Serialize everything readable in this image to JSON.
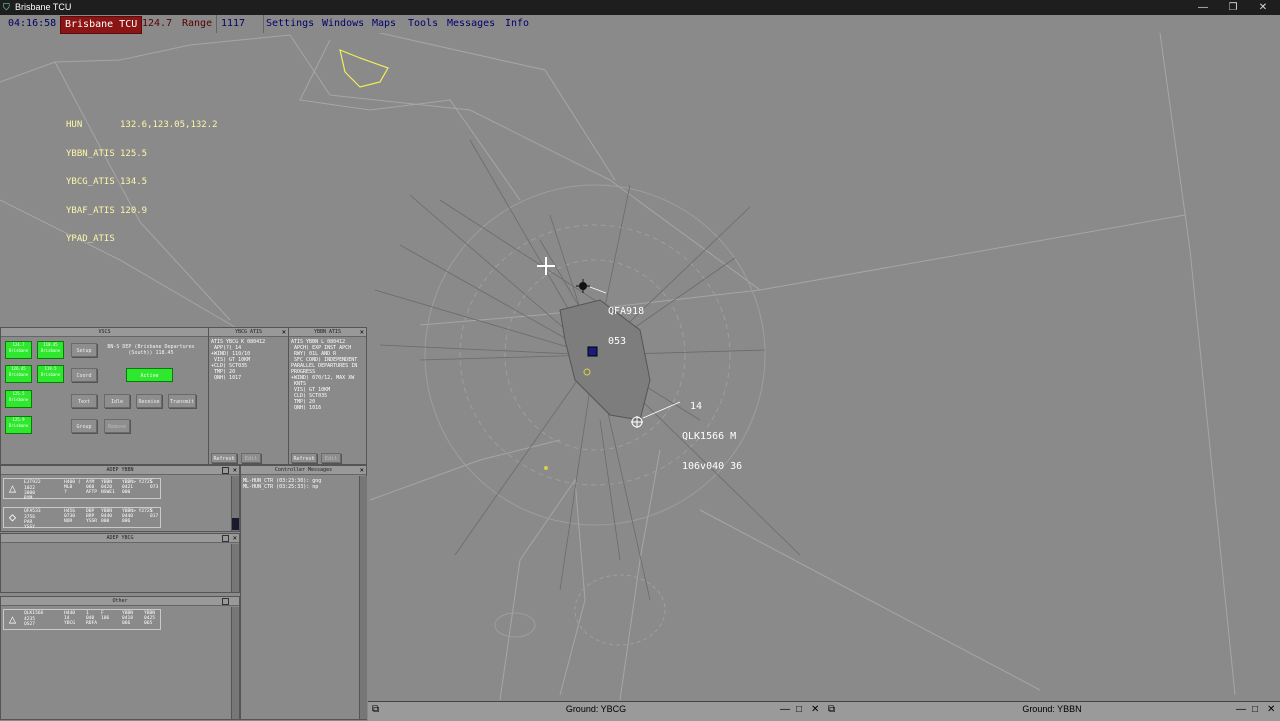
{
  "window": {
    "title": "Brisbane TCU",
    "minimize": "—",
    "restore": "❐",
    "close": "✕"
  },
  "menubar": {
    "clock": "04:16:58",
    "sector": "Brisbane TCU",
    "frequency": "124.7",
    "range_label": "Range",
    "range_value": "1117",
    "menus": [
      "Settings",
      "Windows",
      "Maps",
      "Tools",
      "Messages",
      "Info"
    ]
  },
  "atis_list": [
    {
      "name": "HUN",
      "value": "132.6,123.05,132.2"
    },
    {
      "name": "YBBN_ATIS",
      "value": "125.5"
    },
    {
      "name": "YBCG_ATIS",
      "value": "134.5"
    },
    {
      "name": "YBAF_ATIS",
      "value": "120.9"
    },
    {
      "name": "YPAD_ATIS",
      "value": ""
    }
  ],
  "aircraft": [
    {
      "callsign": "QFA918",
      "altitude": "053"
    },
    {
      "callsign": "QLK1566 M",
      "line2": "106v040 36",
      "extra": "14"
    }
  ],
  "vscs": {
    "title": "VSCS",
    "freq_buttons": [
      "124.7 Brisbane",
      "118.45 Brisbane",
      "126.45 Brisbane",
      "119.5 Brisbane",
      "125.5 Brisbane",
      "125.9 Brisbane"
    ],
    "info": "BN-S DEP (Brisbane Departures (South)) 118.45",
    "setup": "Setup",
    "coord": "Coord",
    "active": "Active",
    "text": "Text",
    "idle": "Idle",
    "receive": "Receive",
    "transmit": "Transmit",
    "group": "Group",
    "remove": "Remove"
  },
  "ybcg_atis": {
    "title": "YBCG ATIS",
    "text": "ATIS YBCG K 080412\n APP(?) 14\n+WIND) 110/10\n VIS) GT 10KM\n+CLD) SCT035\n TMP) 20\n QNH) 1017",
    "refresh": "Refresh",
    "edit": "Edit"
  },
  "ybbn_atis": {
    "title": "YBBN ATIS",
    "text": "ATIS YBBN L 080412\n APCH) EXP INST APCH\n RWY) 01L AND R\n SFC COND) INDEPENDENT\nPARALLEL DEPARTURES IN\nPROGRESS\n+WIND) 070/12, MAX XW\n KNTS\n VIS) GT 10KM\n CLD) SCT035\n TMP) 20\n QNH) 1016",
    "refresh": "Refresh",
    "edit": "Edit"
  },
  "aDEP_ybbn": {
    "title": "ADEP YBBN",
    "strips": [
      {
        "callsign": "EJT922",
        "c1": "1022\n3000\nRYM",
        "c2": "H400 (\nMLB\n?",
        "c3": "AYM\n060\nAFTP",
        "c4": "YBBN\n0420\nNSWE1",
        "c5": "YBBN> Y2725\n0421\n000",
        "c6": "S\n073"
      },
      {
        "callsign": "QFA533",
        "c1": "3756\nPAR\nYSSY",
        "c2": "H456\n0730\nNOR",
        "c3": "DBP\nBRP\nYSSR",
        "c4": "YBBN\n0440\n000",
        "c5": "YBBN> Y2725\n0440\n006",
        "c6": "S\n017"
      }
    ]
  },
  "aDEP_ybcg": {
    "title": "ADEP YBCG"
  },
  "controller_messages": {
    "title": "Controller Messages",
    "lines": [
      "ML-HUN_CTR (03:23:30): gng",
      "ML-HUN_CTR (03:25:33): np"
    ]
  },
  "other": {
    "title": "Other",
    "strips": [
      {
        "callsign": "QLK1566",
        "c1": "4235\nQS27",
        "c2": "H440\n14\nYBCG",
        "c3": "1\n040\nRDFA",
        "c4": "F\n106",
        "c5": "YBBN\n0418\n066",
        "c6": "YBBN\n0425\n065"
      }
    ]
  },
  "ground_ybcg": {
    "title": "Ground: YBCG"
  },
  "ground_ybbn": {
    "title": "Ground: YBBN"
  }
}
